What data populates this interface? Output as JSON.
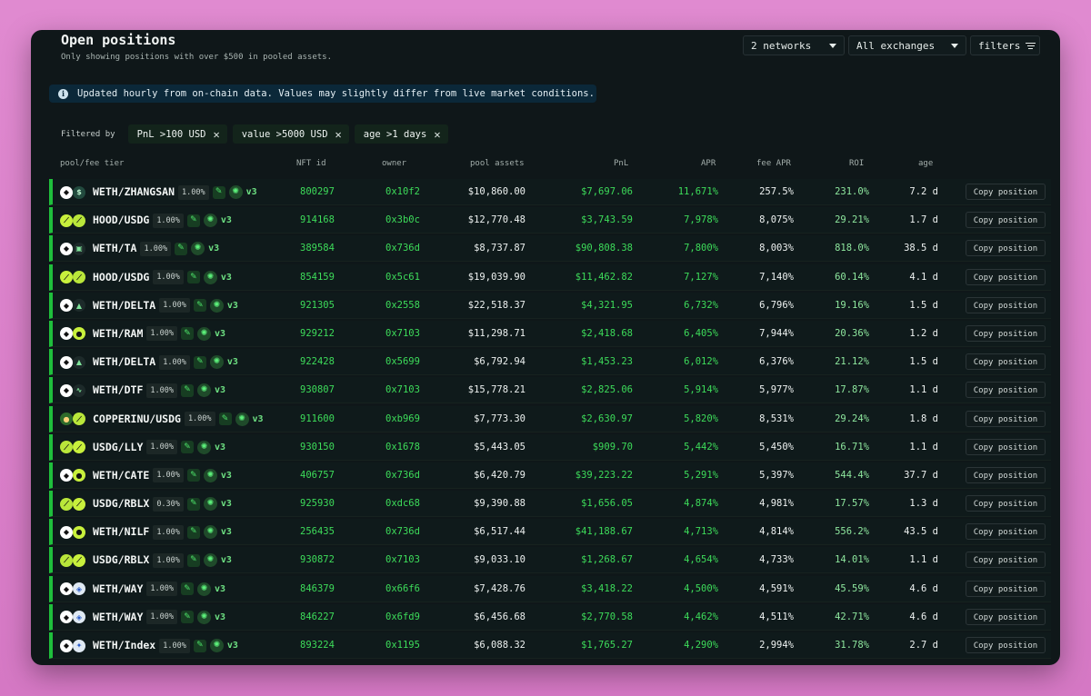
{
  "header": {
    "title": "Open positions",
    "subtitle": "Only showing positions with over $500 in pooled assets.",
    "networks_select": "2 networks",
    "exchanges_select": "All exchanges",
    "filters_label": "filters"
  },
  "notice": {
    "text": "Updated hourly from on-chain data. Values may slightly differ from live market conditions."
  },
  "filter_bar": {
    "label": "Filtered by",
    "chips": [
      "PnL >100 USD",
      "value >5000 USD",
      "age >1 days"
    ]
  },
  "columns": {
    "pool": "pool/fee tier",
    "nft": "NFT id",
    "owner": "owner",
    "assets": "pool assets",
    "pnl": "PnL",
    "apr": "APR",
    "fee_apr": "fee APR",
    "roi": "ROI",
    "age": "age"
  },
  "copy_label": "Copy position",
  "version_label": "v3",
  "rows": [
    {
      "pair": "WETH/ZHANGSAN",
      "fee": "1.00%",
      "nft": "800297",
      "owner": "0x10f2",
      "assets": "$10,860.00",
      "pnl": "$7,697.06",
      "apr": "11,671%",
      "fee_apr": "257.5%",
      "roi": "231.0%",
      "age": "7.2 d",
      "ta": "t-eth",
      "tb": "t-teal",
      "ga": "◆",
      "gb": "$"
    },
    {
      "pair": "HOOD/USDG",
      "fee": "1.00%",
      "nft": "914168",
      "owner": "0x3b0c",
      "assets": "$12,770.48",
      "pnl": "$3,743.59",
      "apr": "7,978%",
      "fee_apr": "8,075%",
      "roi": "29.21%",
      "age": "1.7 d",
      "ta": "t-hood",
      "tb": "t-usdg",
      "ga": "⟋",
      "gb": "⟋"
    },
    {
      "pair": "WETH/TA",
      "fee": "1.00%",
      "nft": "389584",
      "owner": "0x736d",
      "assets": "$8,737.87",
      "pnl": "$90,808.38",
      "apr": "7,800%",
      "fee_apr": "8,003%",
      "roi": "818.0%",
      "age": "38.5 d",
      "ta": "t-eth",
      "tb": "t-dark",
      "ga": "◆",
      "gb": "▣"
    },
    {
      "pair": "HOOD/USDG",
      "fee": "1.00%",
      "nft": "854159",
      "owner": "0x5c61",
      "assets": "$19,039.90",
      "pnl": "$11,462.82",
      "apr": "7,127%",
      "fee_apr": "7,140%",
      "roi": "60.14%",
      "age": "4.1 d",
      "ta": "t-hood",
      "tb": "t-usdg",
      "ga": "⟋",
      "gb": "⟋"
    },
    {
      "pair": "WETH/DELTA",
      "fee": "1.00%",
      "nft": "921305",
      "owner": "0x2558",
      "assets": "$22,518.37",
      "pnl": "$4,321.95",
      "apr": "6,732%",
      "fee_apr": "6,796%",
      "roi": "19.16%",
      "age": "1.5 d",
      "ta": "t-eth",
      "tb": "t-dark",
      "ga": "◆",
      "gb": "▲"
    },
    {
      "pair": "WETH/RAM",
      "fee": "1.00%",
      "nft": "929212",
      "owner": "0x7103",
      "assets": "$11,298.71",
      "pnl": "$2,418.68",
      "apr": "6,405%",
      "fee_apr": "7,944%",
      "roi": "20.36%",
      "age": "1.2 d",
      "ta": "t-eth",
      "tb": "t-hood",
      "ga": "◆",
      "gb": "●"
    },
    {
      "pair": "WETH/DELTA",
      "fee": "1.00%",
      "nft": "922428",
      "owner": "0x5699",
      "assets": "$6,792.94",
      "pnl": "$1,453.23",
      "apr": "6,012%",
      "fee_apr": "6,376%",
      "roi": "21.12%",
      "age": "1.5 d",
      "ta": "t-eth",
      "tb": "t-dark",
      "ga": "◆",
      "gb": "▲"
    },
    {
      "pair": "WETH/DTF",
      "fee": "1.00%",
      "nft": "930807",
      "owner": "0x7103",
      "assets": "$15,778.21",
      "pnl": "$2,825.06",
      "apr": "5,914%",
      "fee_apr": "5,977%",
      "roi": "17.87%",
      "age": "1.1 d",
      "ta": "t-eth",
      "tb": "t-dark",
      "ga": "◆",
      "gb": "∿"
    },
    {
      "pair": "COPPERINU/USDG",
      "fee": "1.00%",
      "nft": "911600",
      "owner": "0xb969",
      "assets": "$7,773.30",
      "pnl": "$2,630.97",
      "apr": "5,820%",
      "fee_apr": "8,531%",
      "roi": "29.24%",
      "age": "1.8 d",
      "ta": "t-cu",
      "tb": "t-usdg",
      "ga": "●",
      "gb": "⟋"
    },
    {
      "pair": "USDG/LLY",
      "fee": "1.00%",
      "nft": "930150",
      "owner": "0x1678",
      "assets": "$5,443.05",
      "pnl": "$909.70",
      "apr": "5,442%",
      "fee_apr": "5,450%",
      "roi": "16.71%",
      "age": "1.1 d",
      "ta": "t-usdg",
      "tb": "t-hood",
      "ga": "⟋",
      "gb": "⟋"
    },
    {
      "pair": "WETH/CATE",
      "fee": "1.00%",
      "nft": "406757",
      "owner": "0x736d",
      "assets": "$6,420.79",
      "pnl": "$39,223.22",
      "apr": "5,291%",
      "fee_apr": "5,397%",
      "roi": "544.4%",
      "age": "37.7 d",
      "ta": "t-eth",
      "tb": "t-hood",
      "ga": "◆",
      "gb": "●"
    },
    {
      "pair": "USDG/RBLX",
      "fee": "0.30%",
      "nft": "925930",
      "owner": "0xdc68",
      "assets": "$9,390.88",
      "pnl": "$1,656.05",
      "apr": "4,874%",
      "fee_apr": "4,981%",
      "roi": "17.57%",
      "age": "1.3 d",
      "ta": "t-usdg",
      "tb": "t-hood",
      "ga": "⟋",
      "gb": "⟋"
    },
    {
      "pair": "WETH/NILF",
      "fee": "1.00%",
      "nft": "256435",
      "owner": "0x736d",
      "assets": "$6,517.44",
      "pnl": "$41,188.67",
      "apr": "4,713%",
      "fee_apr": "4,814%",
      "roi": "556.2%",
      "age": "43.5 d",
      "ta": "t-eth",
      "tb": "t-hood",
      "ga": "◆",
      "gb": "●"
    },
    {
      "pair": "USDG/RBLX",
      "fee": "1.00%",
      "nft": "930872",
      "owner": "0x7103",
      "assets": "$9,033.10",
      "pnl": "$1,268.67",
      "apr": "4,654%",
      "fee_apr": "4,733%",
      "roi": "14.01%",
      "age": "1.1 d",
      "ta": "t-usdg",
      "tb": "t-hood",
      "ga": "⟋",
      "gb": "⟋"
    },
    {
      "pair": "WETH/WAY",
      "fee": "1.00%",
      "nft": "846379",
      "owner": "0x66f6",
      "assets": "$7,428.76",
      "pnl": "$3,418.22",
      "apr": "4,500%",
      "fee_apr": "4,591%",
      "roi": "45.59%",
      "age": "4.6 d",
      "ta": "t-eth",
      "tb": "t-blue",
      "ga": "◆",
      "gb": "◈"
    },
    {
      "pair": "WETH/WAY",
      "fee": "1.00%",
      "nft": "846227",
      "owner": "0x6fd9",
      "assets": "$6,456.68",
      "pnl": "$2,770.58",
      "apr": "4,462%",
      "fee_apr": "4,511%",
      "roi": "42.71%",
      "age": "4.6 d",
      "ta": "t-eth",
      "tb": "t-blue",
      "ga": "◆",
      "gb": "◈"
    },
    {
      "pair": "WETH/Index",
      "fee": "1.00%",
      "nft": "893224",
      "owner": "0x1195",
      "assets": "$6,088.32",
      "pnl": "$1,765.27",
      "apr": "4,290%",
      "fee_apr": "2,994%",
      "roi": "31.78%",
      "age": "2.7 d",
      "ta": "t-eth",
      "tb": "t-blue",
      "ga": "◆",
      "gb": "✦"
    }
  ]
}
